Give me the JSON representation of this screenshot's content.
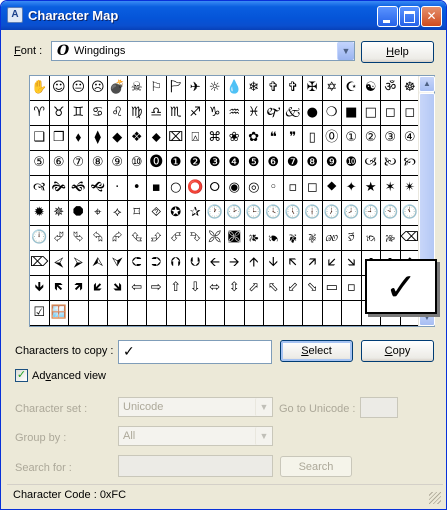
{
  "window": {
    "title": "Character Map",
    "app_icon": "A",
    "minimize_label": "",
    "maximize_label": "",
    "close_label": "✕"
  },
  "font": {
    "label_prefix": "F",
    "label_rest": "ont :",
    "icon": "O",
    "value": "Wingdings",
    "dropdown_arrow": "▼"
  },
  "help_button": {
    "prefix": "",
    "u": "H",
    "rest": "elp"
  },
  "grid": {
    "rows": [
      [
        "✋",
        "☺",
        "😐",
        "☹",
        "💣",
        "☠",
        "⚐",
        "🏱",
        "✈",
        "☼",
        "💧",
        "❄",
        "✞",
        "✞",
        "✠",
        "✡",
        "☪",
        "☯",
        "ॐ",
        "☸"
      ],
      [
        "♈",
        "♉",
        "♊",
        "♋",
        "♌",
        "♍",
        "♎",
        "♏",
        "♐",
        "♑",
        "♒",
        "♓",
        "🙰",
        "🙵",
        "●",
        "❍",
        "■",
        "□",
        "◻",
        "◻"
      ],
      [
        "❑",
        "❒",
        "⬧",
        "⧫",
        "◆",
        "❖",
        "⬥",
        "⌧",
        "⍓",
        "⌘",
        "❀",
        "✿",
        "❝",
        "❞",
        "▯",
        "⓪",
        "①",
        "②",
        "③",
        "④"
      ],
      [
        "⑤",
        "⑥",
        "⑦",
        "⑧",
        "⑨",
        "⑩",
        "⓿",
        "❶",
        "❷",
        "❸",
        "❹",
        "❺",
        "❻",
        "❼",
        "❽",
        "❾",
        "❿",
        "🙢",
        "🙠",
        "🙡"
      ],
      [
        "🙣",
        "🙞",
        "🙜",
        "🙝",
        "·",
        "•",
        "▪",
        "○",
        "⭕",
        "⭘",
        "◉",
        "◎",
        "◦",
        "▫",
        "◻",
        "⯁",
        "✦",
        "★",
        "✶",
        "✴"
      ],
      [
        "✹",
        "✵",
        "⯃",
        "⌖",
        "⟡",
        "⌑",
        "⯑",
        "✪",
        "✰",
        "🕐",
        "🕑",
        "🕒",
        "🕓",
        "🕔",
        "🕕",
        "🕖",
        "🕗",
        "🕘",
        "🕙",
        "🕚"
      ],
      [
        "🕛",
        "⮰",
        "⮱",
        "⮲",
        "⮳",
        "⮴",
        "⮵",
        "⮶",
        "⮷",
        "🙪",
        "🙫",
        "🙕",
        "🙔",
        "🙗",
        "🙖",
        "🙐",
        "🙑",
        "🙒",
        "🙓",
        "⌫"
      ],
      [
        "⌦",
        "⮘",
        "⮚",
        "⮙",
        "⮛",
        "⮈",
        "⮊",
        "⮉",
        "⮋",
        "🡨",
        "🡪",
        "🡩",
        "🡫",
        "🡬",
        "🡭",
        "🡯",
        "🡮",
        "🡸",
        "🡺",
        "🡹"
      ],
      [
        "🡻",
        "🡼",
        "🡽",
        "🡿",
        "🡾",
        "⇦",
        "⇨",
        "⇧",
        "⇩",
        "⬄",
        "⇳",
        "⬀",
        "⬁",
        "⬃",
        "⬂",
        "▭",
        "▫",
        "✗",
        "✓",
        "☒"
      ],
      [
        "☑",
        "🪟",
        "",
        "",
        "",
        "",
        "",
        "",
        "",
        "",
        "",
        "",
        "",
        "",
        "",
        "",
        "",
        "",
        "",
        ""
      ]
    ],
    "selected_row": 8,
    "selected_col": 18,
    "magnified_char": "✓",
    "scroll_up": "▲",
    "scroll_down": "▼"
  },
  "copy": {
    "label": "Characters to copy :",
    "value": "✓",
    "select_button": {
      "u": "S",
      "rest": "elect"
    },
    "copy_button": {
      "u": "C",
      "rest": "opy"
    }
  },
  "advanced": {
    "checked_mark": "✓",
    "label_prefix": "Ad",
    "label_u": "v",
    "label_rest": "anced view"
  },
  "character_set": {
    "label": "Character set :",
    "value": "Unicode",
    "goto_label": "Go to Unicode :",
    "goto_value": ""
  },
  "group_by": {
    "label": "Group by :",
    "value": "All"
  },
  "search": {
    "label": "Search for :",
    "value": "",
    "button": "Search"
  },
  "status": {
    "text": "Character Code : 0xFC"
  },
  "colors": {
    "title_bar": "#0554d8",
    "selection": "#316ac5",
    "window_bg": "#ece9d8"
  }
}
